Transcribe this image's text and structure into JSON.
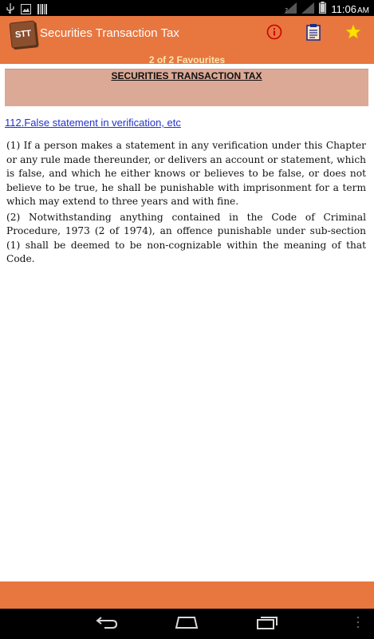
{
  "status_bar": {
    "time": "11:06",
    "time_suffix": "AM"
  },
  "action_bar": {
    "app_icon_text": "STT",
    "title": "Securities Transaction Tax",
    "icons": [
      "info-icon",
      "clipboard-icon",
      "star-icon"
    ]
  },
  "favourites": {
    "label": "2 of 2 Favourites"
  },
  "content": {
    "header": "SECURITIES TRANSACTION TAX",
    "section_link": "112.False statement in verification, etc",
    "paragraphs": [
      "(1) If a person makes a statement in any verification under this Chapter or any rule made thereunder, or delivers an account or statement, which is false, and which he either knows or believes to be false, or does not believe to be true, he shall be punishable with imprisonment for a term which may extend to three years and with fine.",
      "(2) Notwithstanding anything contained in the Code of Criminal Procedure, 1973 (2 of 1974), an offence punishable under sub-section (1) shall be deemed to be non-cognizable within the meaning of that Code."
    ]
  },
  "colors": {
    "accent": "#e8763f",
    "header_bg": "#dca996",
    "link": "#2233cc",
    "favourites_text": "#fde6b0"
  }
}
